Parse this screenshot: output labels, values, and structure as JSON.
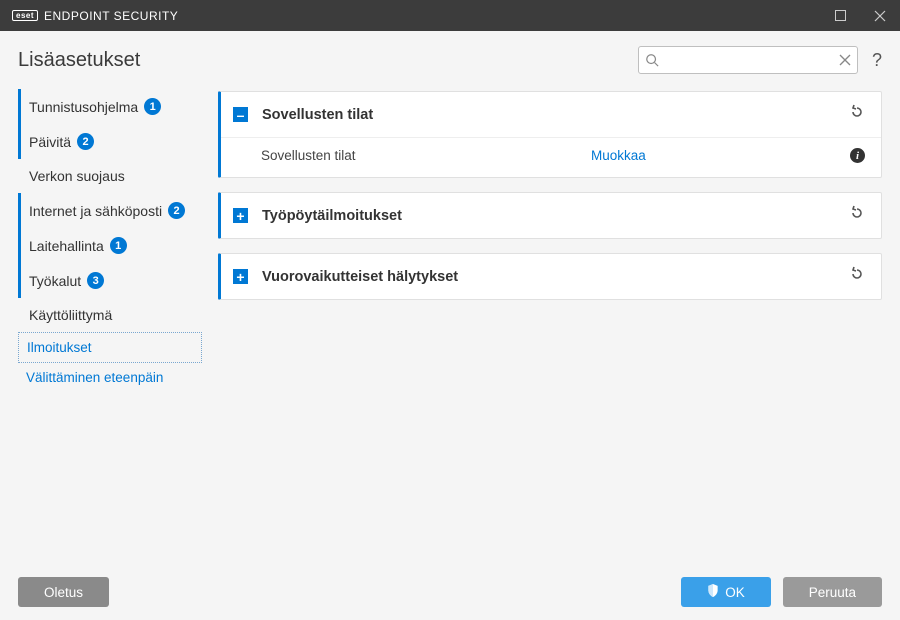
{
  "titlebar": {
    "brand_box": "eset",
    "brand_text": "ENDPOINT SECURITY"
  },
  "header": {
    "title": "Lisäasetukset",
    "search_placeholder": "",
    "help": "?"
  },
  "sidebar": {
    "items": [
      {
        "label": "Tunnistusohjelma",
        "badge": "1"
      },
      {
        "label": "Päivitä",
        "badge": "2"
      },
      {
        "label": "Verkon suojaus",
        "badge": ""
      },
      {
        "label": "Internet ja sähköposti",
        "badge": "2"
      },
      {
        "label": "Laitehallinta",
        "badge": "1"
      },
      {
        "label": "Työkalut",
        "badge": "3"
      },
      {
        "label": "Käyttöliittymä",
        "badge": ""
      }
    ],
    "children": [
      {
        "label": "Ilmoitukset",
        "selected": true
      },
      {
        "label": "Välittäminen eteenpäin",
        "selected": false
      }
    ]
  },
  "panels": {
    "p0": {
      "expander": "–",
      "title": "Sovellusten tilat",
      "row_label": "Sovellusten tilat",
      "row_action": "Muokkaa"
    },
    "p1": {
      "expander": "+",
      "title": "Työpöytäilmoitukset"
    },
    "p2": {
      "expander": "+",
      "title": "Vuorovaikutteiset hälytykset"
    }
  },
  "footer": {
    "default": "Oletus",
    "ok": "OK",
    "cancel": "Peruuta"
  }
}
